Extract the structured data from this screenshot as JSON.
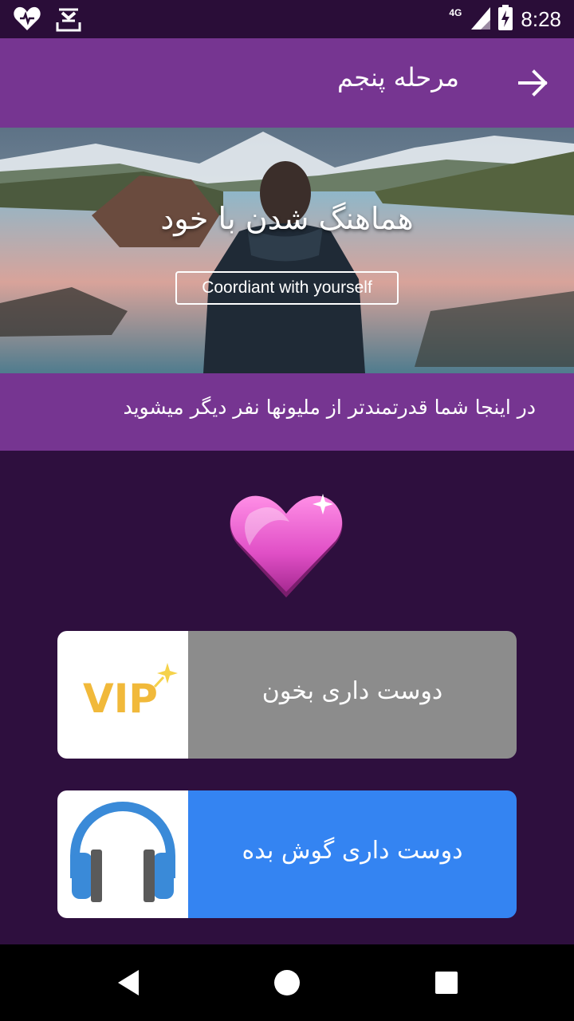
{
  "status_bar": {
    "time": "8:28",
    "network": "4G",
    "left_icons": [
      "heart-app-icon",
      "download-icon"
    ],
    "right_icons": [
      "signal-icon",
      "battery-charging-icon"
    ]
  },
  "app_bar": {
    "title": "مرحله پنجم",
    "back_icon": "arrow-icon"
  },
  "hero": {
    "title": "هماهنگ شدن با خود",
    "subtitle": "Coordiant with yourself"
  },
  "tagline": "در اینجا شما قدرتمندتر از ملیونها نفر دیگر میشوید",
  "actions": [
    {
      "label": "دوست داری بخون",
      "icon": "vip-icon",
      "icon_text": "VIP",
      "color": "#8c8c8c"
    },
    {
      "label": "دوست داری گوش بده",
      "icon": "headphones-icon",
      "color": "#3484f2"
    }
  ],
  "nav_bar": {
    "buttons": [
      "back-triangle-icon",
      "home-circle-icon",
      "recents-square-icon"
    ]
  },
  "colors": {
    "primary": "#763591",
    "background": "#2e0f3e",
    "status_bar": "#2a0d38"
  }
}
